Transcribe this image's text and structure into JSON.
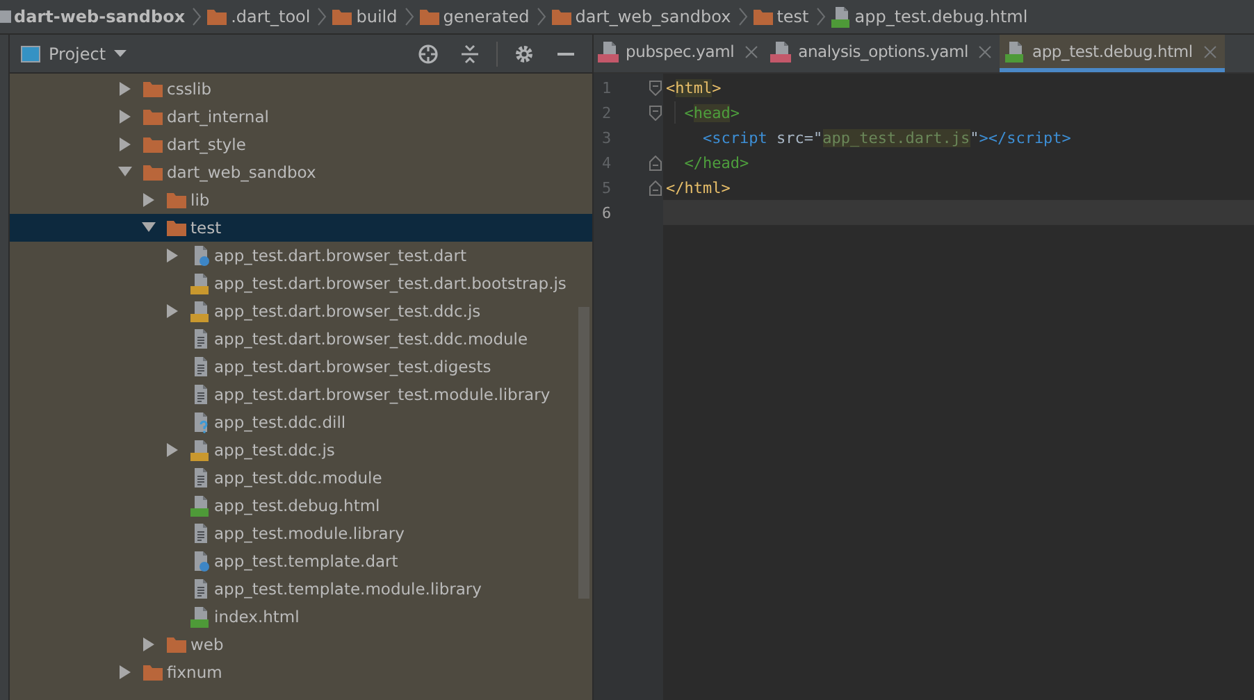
{
  "breadcrumbs": [
    {
      "label": "dart-web-sandbox",
      "kind": "project"
    },
    {
      "label": ".dart_tool",
      "kind": "folder"
    },
    {
      "label": "build",
      "kind": "folder"
    },
    {
      "label": "generated",
      "kind": "folder"
    },
    {
      "label": "dart_web_sandbox",
      "kind": "folder"
    },
    {
      "label": "test",
      "kind": "folder"
    },
    {
      "label": "app_test.debug.html",
      "kind": "html"
    }
  ],
  "project_panel": {
    "title": "Project",
    "tree": [
      {
        "label": "csslib",
        "kind": "folder",
        "expanded": false,
        "selected": false
      },
      {
        "label": "dart_internal",
        "kind": "folder",
        "expanded": false,
        "selected": false
      },
      {
        "label": "dart_style",
        "kind": "folder",
        "expanded": false,
        "selected": false
      },
      {
        "label": "dart_web_sandbox",
        "kind": "folder",
        "expanded": true,
        "selected": false,
        "children": [
          {
            "label": "lib",
            "kind": "folder",
            "expanded": false,
            "selected": false
          },
          {
            "label": "test",
            "kind": "folder",
            "expanded": true,
            "selected": true,
            "children": [
              {
                "label": "app_test.dart.browser_test.dart",
                "kind": "dart",
                "expanded": false,
                "selected": false
              },
              {
                "label": "app_test.dart.browser_test.dart.bootstrap.js",
                "kind": "js",
                "selected": false
              },
              {
                "label": "app_test.dart.browser_test.ddc.js",
                "kind": "js",
                "expanded": false,
                "selected": false
              },
              {
                "label": "app_test.dart.browser_test.ddc.module",
                "kind": "text",
                "selected": false
              },
              {
                "label": "app_test.dart.browser_test.digests",
                "kind": "text",
                "selected": false
              },
              {
                "label": "app_test.dart.browser_test.module.library",
                "kind": "text",
                "selected": false
              },
              {
                "label": "app_test.ddc.dill",
                "kind": "unknown",
                "selected": false
              },
              {
                "label": "app_test.ddc.js",
                "kind": "js",
                "expanded": false,
                "selected": false
              },
              {
                "label": "app_test.ddc.module",
                "kind": "text",
                "selected": false
              },
              {
                "label": "app_test.debug.html",
                "kind": "html",
                "selected": false
              },
              {
                "label": "app_test.module.library",
                "kind": "text",
                "selected": false
              },
              {
                "label": "app_test.template.dart",
                "kind": "dart",
                "selected": false
              },
              {
                "label": "app_test.template.module.library",
                "kind": "text",
                "selected": false
              },
              {
                "label": "index.html",
                "kind": "html",
                "selected": false
              }
            ]
          },
          {
            "label": "web",
            "kind": "folder",
            "expanded": false,
            "selected": false
          }
        ]
      },
      {
        "label": "fixnum",
        "kind": "folder",
        "expanded": false,
        "selected": false
      }
    ]
  },
  "tabs": [
    {
      "label": "pubspec.yaml",
      "kind": "yaml",
      "selected": false
    },
    {
      "label": "analysis_options.yaml",
      "kind": "yaml",
      "selected": false
    },
    {
      "label": "app_test.debug.html",
      "kind": "html",
      "selected": true
    }
  ],
  "editor": {
    "lines": [
      {
        "number": "1",
        "kind": "fold_start",
        "current": false,
        "tokens": [
          {
            "text": "<",
            "kind": "html"
          },
          {
            "text": "html",
            "kind": "html",
            "highlighted": true
          },
          {
            "text": ">",
            "kind": "html"
          }
        ]
      },
      {
        "number": "2",
        "kind": "fold_start",
        "current": false,
        "tokens": [
          {
            "text": "  <",
            "kind": "head"
          },
          {
            "text": "head",
            "kind": "head",
            "highlighted": true
          },
          {
            "text": ">",
            "kind": "head"
          }
        ]
      },
      {
        "number": "3",
        "kind": "plain",
        "current": false,
        "tokens": [
          {
            "text": "    <script",
            "kind": "script"
          },
          {
            "text": " src=\"",
            "kind": "plain"
          },
          {
            "text": "app_test.dart.js",
            "kind": "string",
            "highlighted": true
          },
          {
            "text": "\"",
            "kind": "plain"
          },
          {
            "text": "></script>",
            "kind": "script"
          }
        ]
      },
      {
        "number": "4",
        "kind": "fold_end",
        "current": false,
        "tokens": [
          {
            "text": "  </head>",
            "kind": "head"
          }
        ]
      },
      {
        "number": "5",
        "kind": "fold_end",
        "current": false,
        "tokens": [
          {
            "text": "</html>",
            "kind": "html"
          }
        ]
      },
      {
        "number": "6",
        "kind": "plain",
        "current": true
      }
    ]
  }
}
